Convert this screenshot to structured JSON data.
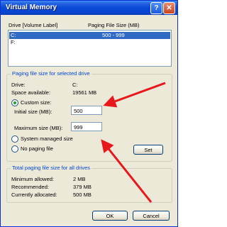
{
  "window": {
    "title": "Virtual Memory",
    "help_button": "?",
    "close_button": "✕"
  },
  "drives": {
    "header_drive": "Drive  [Volume Label]",
    "header_size": "Paging File Size (MB)",
    "rows": [
      {
        "drive": "C:",
        "size": "500 - 999",
        "selected": true
      },
      {
        "drive": "F:",
        "size": "",
        "selected": false
      }
    ]
  },
  "selected_drive": {
    "group_label": "Paging file size for selected drive",
    "drive_label": "Drive:",
    "drive_value": "C:",
    "space_label": "Space available:",
    "space_value": "19561 MB",
    "custom_size_label": "Custom size:",
    "initial_label": "Initial size (MB):",
    "initial_value": "500",
    "maximum_label": "Maximum size (MB):",
    "maximum_value": "999",
    "system_managed_label": "System managed size",
    "no_paging_label": "No paging file",
    "set_button": "Set",
    "selected_option": "custom"
  },
  "totals": {
    "group_label": "Total paging file size for all drives",
    "minimum_label": "Minimum allowed:",
    "minimum_value": "2 MB",
    "recommended_label": "Recommended:",
    "recommended_value": "379 MB",
    "allocated_label": "Currently allocated:",
    "allocated_value": "500 MB"
  },
  "footer": {
    "ok_button": "OK",
    "cancel_button": "Cancel"
  },
  "colors": {
    "annotation_arrow": "#e8171c",
    "title_bar": "#0a4ad7",
    "selection": "#316ac5"
  }
}
